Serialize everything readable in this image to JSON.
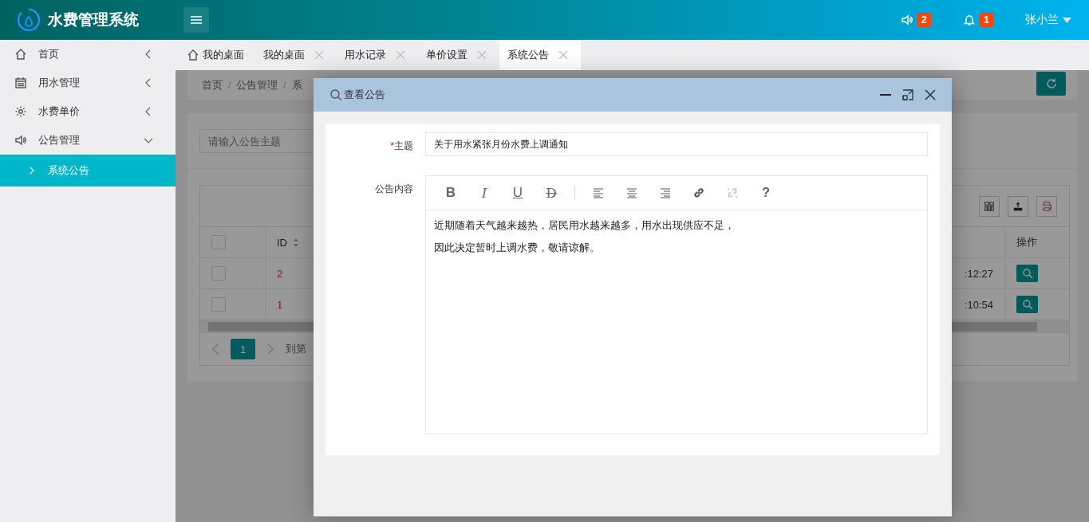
{
  "app": {
    "title": "水费管理系统"
  },
  "header": {
    "notices": [
      {
        "kind": "speaker",
        "badge": "2"
      },
      {
        "kind": "bell",
        "badge": "1"
      }
    ],
    "user": "张小兰"
  },
  "sidebar": {
    "items": [
      {
        "label": "首页",
        "kind": "home",
        "expanded": false
      },
      {
        "label": "用水管理",
        "kind": "calendar",
        "expanded": false
      },
      {
        "label": "水费单价",
        "kind": "gear",
        "expanded": false
      },
      {
        "label": "公告管理",
        "kind": "speaker",
        "expanded": true,
        "children": [
          {
            "label": "系统公告",
            "selected": true
          }
        ]
      }
    ]
  },
  "tabs": [
    {
      "label": "我的桌面",
      "kind": "home",
      "selected": false
    },
    {
      "label": "我的桌面",
      "kind": "closable",
      "selected": false
    },
    {
      "label": "用水记录",
      "kind": "closable",
      "selected": false
    },
    {
      "label": "单价设置",
      "kind": "closable",
      "selected": false
    },
    {
      "label": "系统公告",
      "kind": "closable",
      "selected": true
    }
  ],
  "page": {
    "breadcrumb": [
      {
        "kind": "link",
        "label": "首页"
      },
      {
        "kind": "separator",
        "label": "/"
      },
      {
        "kind": "link",
        "label": "公告管理"
      },
      {
        "kind": "separator",
        "label": "/"
      },
      {
        "kind": "link",
        "label": "系"
      }
    ],
    "search": {
      "placeholder": "请输入公告主题"
    },
    "table": {
      "header_checked": false,
      "columns": [
        {
          "label": "ID",
          "sortable": true
        },
        {
          "label": "操作",
          "sortable": false
        }
      ],
      "rows": [
        {
          "checked": false,
          "id": "2",
          "time": ":12:27"
        },
        {
          "checked": false,
          "id": "1",
          "time": ":10:54"
        }
      ]
    },
    "pagination": {
      "page": "1",
      "goto": "到第"
    }
  },
  "dialog": {
    "title": "查看公告",
    "fields": [
      {
        "kind": "input",
        "label": "主题",
        "required_mark": "*",
        "value": "关于用水紧张月份水费上调通知"
      },
      {
        "kind": "editor",
        "label": "公告内容",
        "tools": [
          {
            "kind": "bold",
            "label": "B",
            "disabled": false
          },
          {
            "kind": "italic",
            "label": "I",
            "disabled": false
          },
          {
            "kind": "underline",
            "label": "U",
            "disabled": false
          },
          {
            "kind": "strike",
            "label": "D",
            "disabled": false
          },
          {
            "kind": "separator"
          },
          {
            "kind": "align-left",
            "disabled": false
          },
          {
            "kind": "align-center",
            "disabled": false
          },
          {
            "kind": "align-right",
            "disabled": false
          },
          {
            "kind": "link",
            "disabled": false
          },
          {
            "kind": "unlink",
            "disabled": true
          },
          {
            "kind": "help",
            "label": "?",
            "disabled": false
          }
        ],
        "paragraphs": [
          "近期随着天气越来越热，居民用水越来越多，用水出现供应不足，",
          "因此决定暂时上调水费，敬请谅解。"
        ]
      }
    ]
  }
}
